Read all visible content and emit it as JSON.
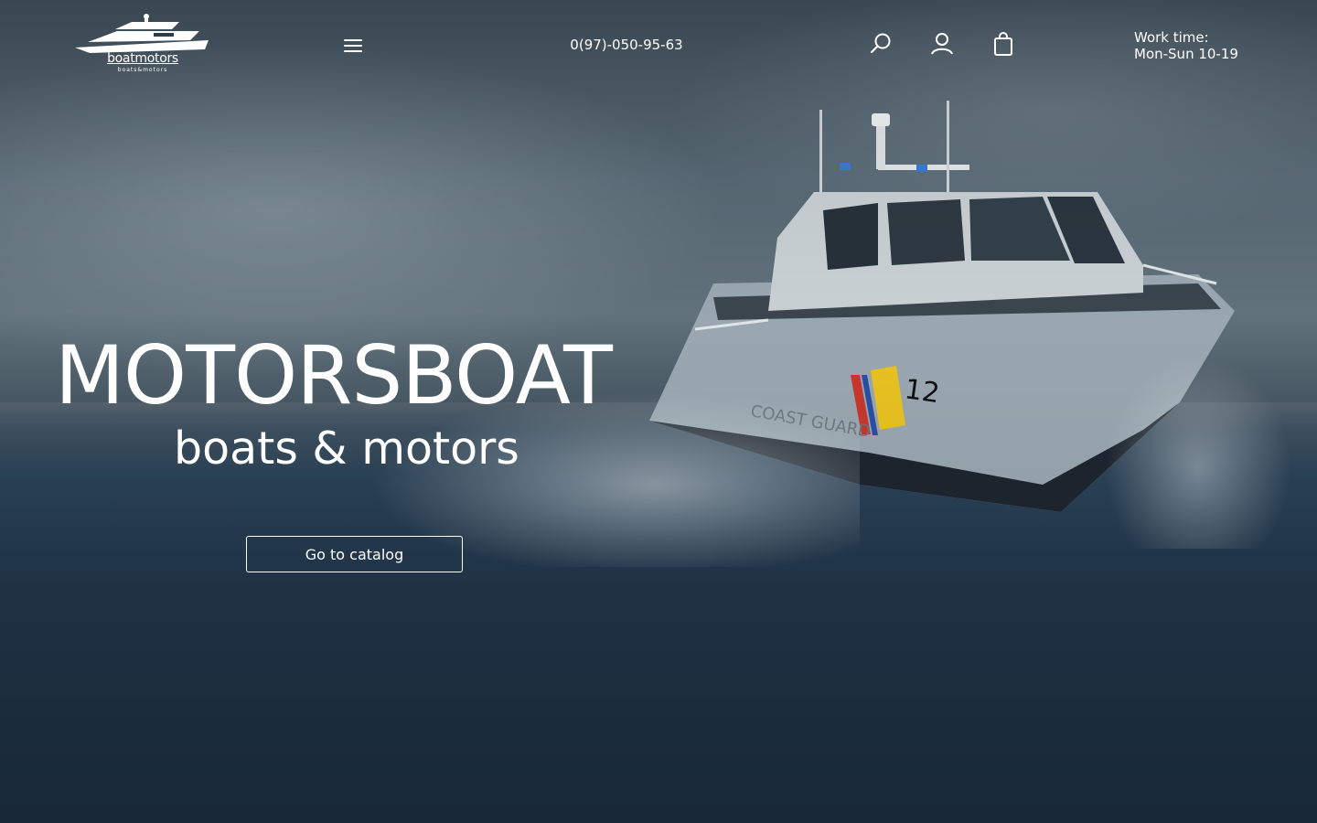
{
  "header": {
    "logo": {
      "name": "boatmotors",
      "tagline": "boats&motors",
      "icon": "yacht-icon"
    },
    "menu_icon": "hamburger-menu-icon",
    "phone": "0(97)-050-95-63",
    "icons": [
      "search-icon",
      "user-icon",
      "shopping-bag-icon"
    ],
    "work_time": {
      "label": "Work time:",
      "hours": "Mon-Sun 10-19"
    }
  },
  "hero": {
    "title": "MOTORSBOAT",
    "subtitle": "boats & motors",
    "cta_label": "Go to catalog",
    "background": "coast-guard-boat-on-stormy-sea",
    "boat_markings": {
      "number": "12",
      "text": "COAST GUARD"
    }
  },
  "colors": {
    "text": "#ffffff",
    "sea": "#1f3447",
    "sky": "#5b6b76"
  }
}
